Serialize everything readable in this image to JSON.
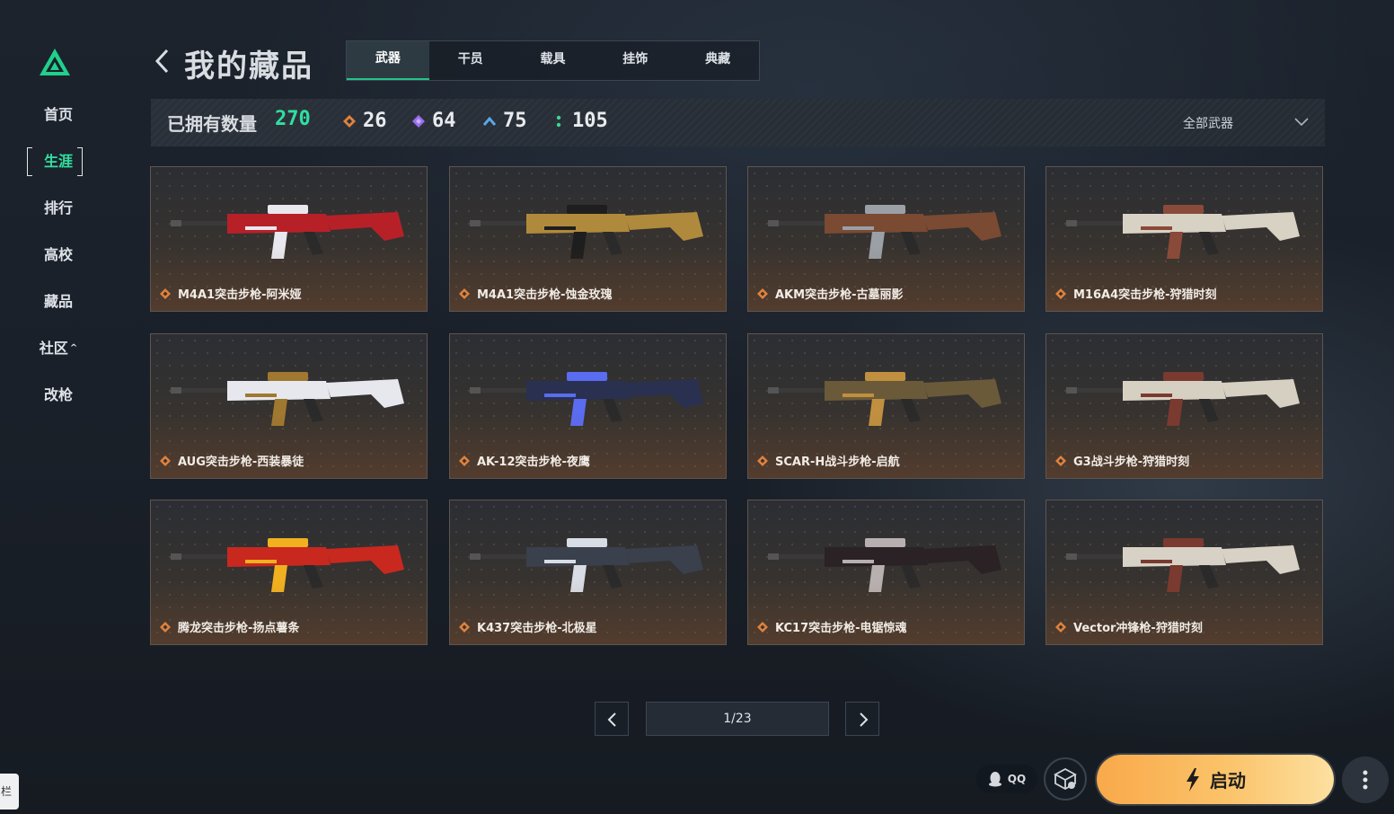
{
  "nav": {
    "items": [
      {
        "label": "首页"
      },
      {
        "label": "生涯",
        "active": true
      },
      {
        "label": "排行"
      },
      {
        "label": "高校"
      },
      {
        "label": "藏品"
      },
      {
        "label": "社区",
        "caret": "^"
      },
      {
        "label": "改枪"
      }
    ]
  },
  "header": {
    "title": "我的藏品",
    "tabs": [
      "武器",
      "干员",
      "载具",
      "挂饰",
      "典藏"
    ],
    "active_tab": "武器"
  },
  "stats": {
    "owned_label": "已拥有数量",
    "owned_count": "270",
    "rarities": [
      {
        "icon": "orange-diamond-icon",
        "color": "#e0823c",
        "count": "26"
      },
      {
        "icon": "purple-diamond-icon",
        "color": "#9b6df0",
        "count": "64"
      },
      {
        "icon": "blue-chevron-icon",
        "color": "#5aa8e8",
        "count": "75"
      },
      {
        "icon": "green-dots-icon",
        "color": "#3cd690",
        "count": "105"
      }
    ],
    "filter_label": "全部武器"
  },
  "items": [
    {
      "name": "M4A1突击步枪-阿米娅",
      "accent": "#b82028",
      "accent2": "#e8e8ee"
    },
    {
      "name": "M4A1突击步枪-蚀金玫瑰",
      "accent": "#b08a3c",
      "accent2": "#1e1e1e"
    },
    {
      "name": "AKM突击步枪-古墓丽影",
      "accent": "#7a4a32",
      "accent2": "#9aa0a6"
    },
    {
      "name": "M16A4突击步枪-狩猎时刻",
      "accent": "#d8d2c4",
      "accent2": "#8a4a3a"
    },
    {
      "name": "AUG突击步枪-西装暴徒",
      "accent": "#e6e8ee",
      "accent2": "#a07830"
    },
    {
      "name": "AK-12突击步枪-夜鹰",
      "accent": "#2a3050",
      "accent2": "#5a6cf0"
    },
    {
      "name": "SCAR-H战斗步枪-启航",
      "accent": "#6a5a3a",
      "accent2": "#c09040"
    },
    {
      "name": "G3战斗步枪-狩猎时刻",
      "accent": "#d6d0c2",
      "accent2": "#7a3a30"
    },
    {
      "name": "腾龙突击步枪-扬点薯条",
      "accent": "#c8281e",
      "accent2": "#f0b020"
    },
    {
      "name": "K437突击步枪-北极星",
      "accent": "#3a404c",
      "accent2": "#d8dce4"
    },
    {
      "name": "KC17突击步枪-电锯惊魂",
      "accent": "#2a2224",
      "accent2": "#b8b0b0"
    },
    {
      "name": "Vector冲锋枪-狩猎时刻",
      "accent": "#d8d2c6",
      "accent2": "#7a3a30"
    }
  ],
  "pagination": {
    "display": "1/23"
  },
  "footer": {
    "qq_label": "QQ",
    "launch_label": "启动",
    "side_tab_label": "栏"
  },
  "colors": {
    "accent_green": "#2fe0a0",
    "launch_orange": "#f9a94a"
  }
}
